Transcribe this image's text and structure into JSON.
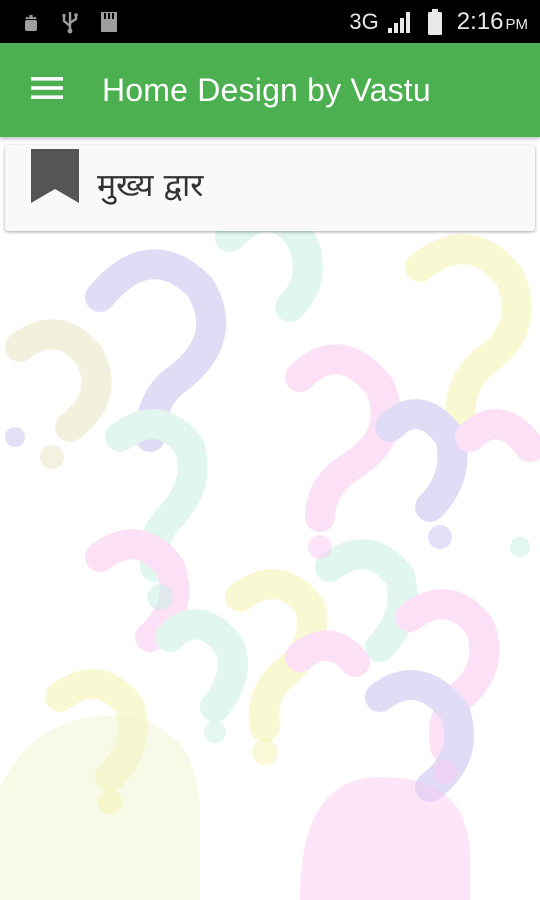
{
  "status_bar": {
    "network": "3G",
    "time": "2:16",
    "ampm": "PM",
    "icons": [
      "android-debug-icon",
      "usb-icon",
      "sd-card-icon",
      "signal-icon",
      "battery-icon"
    ]
  },
  "app_bar": {
    "title": "Home Design by Vastu",
    "menu_icon": "hamburger-menu-icon",
    "color": "#4caf50"
  },
  "list": {
    "items": [
      {
        "label": "मुख्य द्वार",
        "icon": "bookmark-icon"
      }
    ]
  }
}
